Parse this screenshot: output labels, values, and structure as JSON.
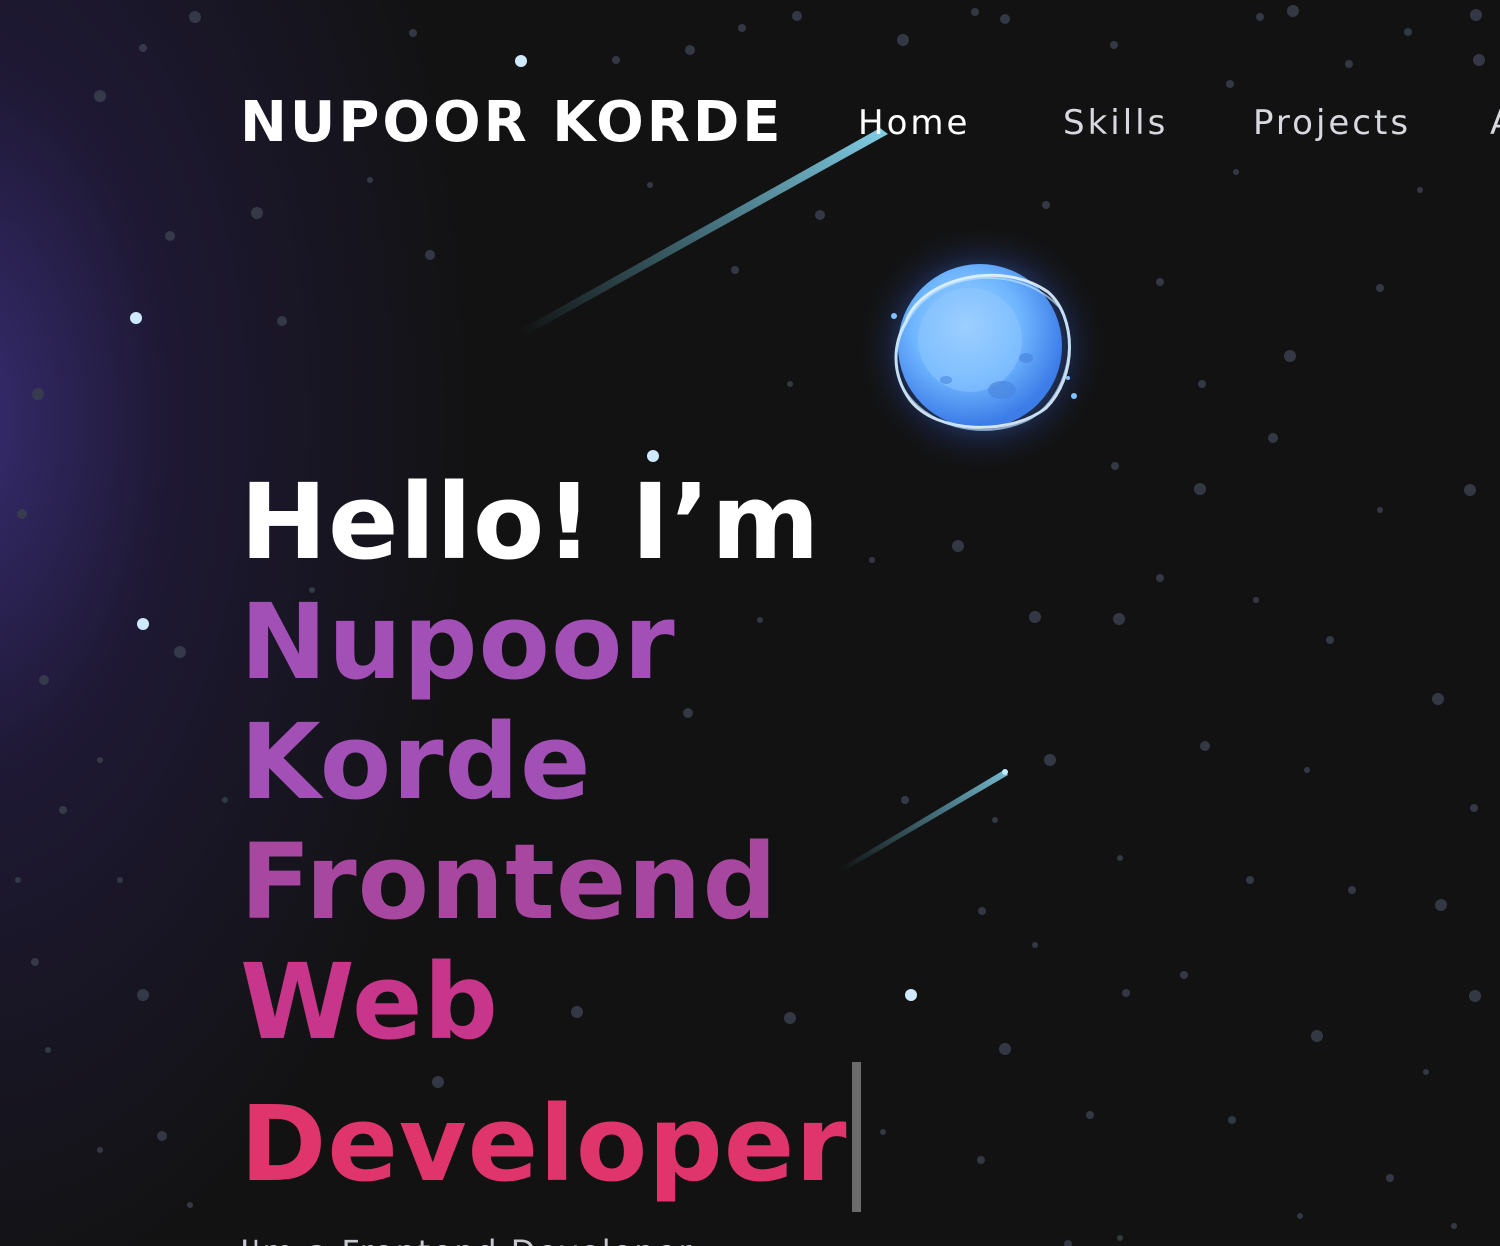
{
  "brand": {
    "name": "NUPOOR KORDE"
  },
  "nav": {
    "items": [
      {
        "label": "Home",
        "active": true
      },
      {
        "label": "Skills",
        "active": false
      },
      {
        "label": "Projects",
        "active": false
      },
      {
        "label": "A",
        "active": false
      }
    ]
  },
  "hero": {
    "greeting": "Hello! I’m",
    "typed_lines": [
      "Nupoor",
      "Korde",
      "Frontend",
      "Web",
      "Developer"
    ],
    "subtitle": "I'm a Frontend Developer"
  },
  "colors": {
    "background": "#121212",
    "nebula": "#3a2e78",
    "name_purple": "#a24fb6",
    "mid_magenta": "#c7368a",
    "end_pink": "#df356c",
    "planet_blue": "#6fb6ff"
  },
  "icons": {
    "planet": "planet-icon",
    "shooting_star": "shooting-star-icon",
    "caret": "text-caret"
  }
}
